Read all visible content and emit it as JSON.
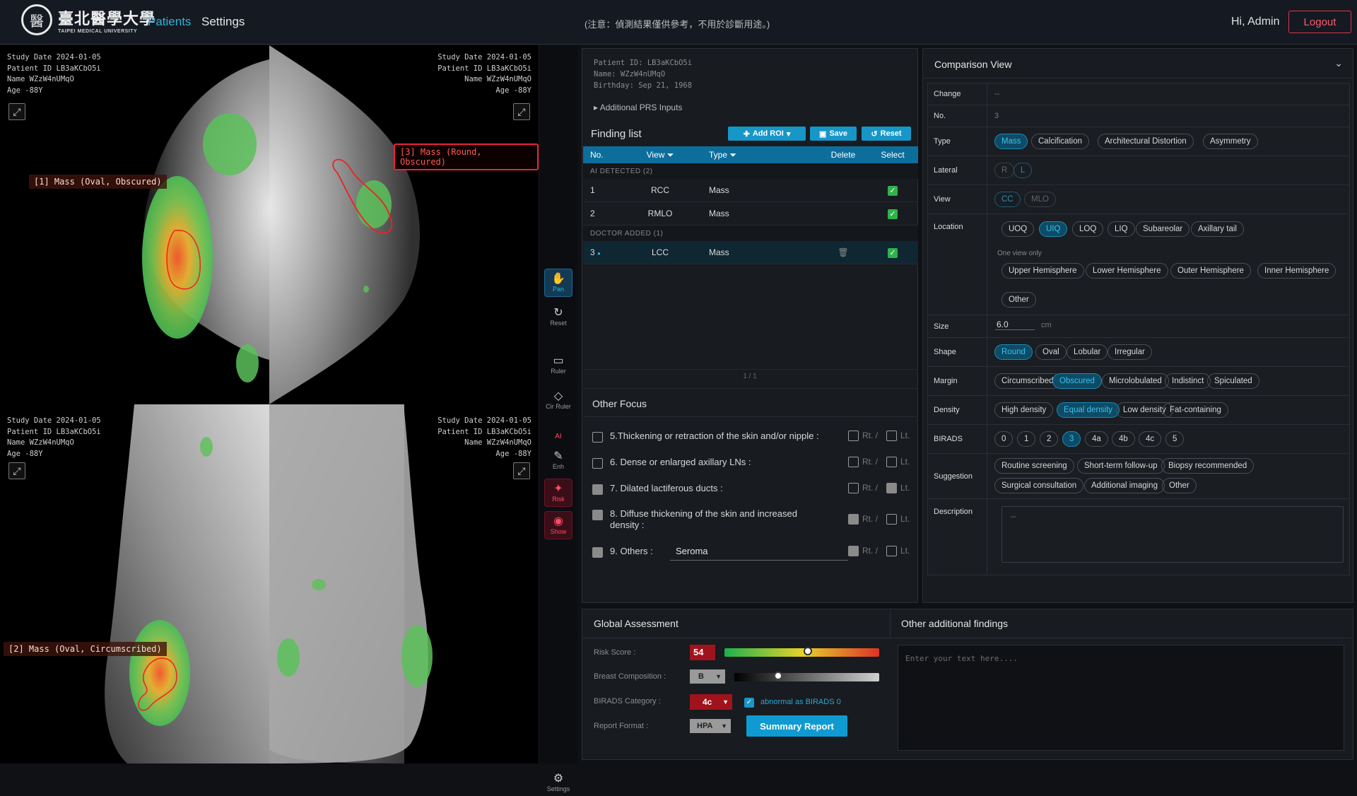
{
  "header": {
    "logo_cn": "臺北醫學大學",
    "logo_en": "TAIPEI MEDICAL UNIVERSITY",
    "nav": [
      "Patients",
      "Settings"
    ],
    "notice": "(注意：偵測結果僅供參考，不用於診斷用途。)",
    "greeting": "Hi, Admin",
    "logout": "Logout"
  },
  "viewer": {
    "rcc": {
      "study_date": "Study Date 2024-01-05",
      "patient_id": "Patient ID LB3aKCbO5i",
      "name": "Name WZzW4nUMqO",
      "age": "Age -88Y"
    },
    "lcc": {
      "study_date": "Study Date 2024-01-05",
      "patient_id": "Patient ID LB3aKCbO5i",
      "name": "Name WZzW4nUMqO",
      "age": "Age -88Y"
    },
    "rmlo": {
      "study_date": "Study Date 2024-01-05",
      "patient_id": "Patient ID LB3aKCbO5i",
      "name": "Name WZzW4nUMqO",
      "age": "Age -88Y"
    },
    "lmlo": {
      "study_date": "Study Date 2024-01-05",
      "patient_id": "Patient ID LB3aKCbO5i",
      "name": "Name WZzW4nUMqO",
      "age": "Age -88Y"
    },
    "labels": {
      "f1": "[1] Mass (Oval, Obscured)",
      "f2": "[2] Mass (Oval, Circumscribed)",
      "f3": "[3] Mass (Round, Obscured)"
    }
  },
  "tools": {
    "pan": "Pan",
    "reset": "Reset",
    "ruler": "Ruler",
    "cir_ruler": "Cir Ruler",
    "ai": "AI",
    "enh": "Enh",
    "risk": "Risk",
    "show": "Show",
    "settings": "Settings"
  },
  "patient": {
    "id": "Patient ID: LB3aKCbO5i",
    "name": "Name: WZzW4nUMqO",
    "birthday": "Birthday: Sep 21, 1968",
    "additional_prs": "▸ Additional PRS Inputs"
  },
  "finding_list": {
    "title": "Finding list",
    "add_roi": "Add ROI",
    "save": "Save",
    "reset": "Reset",
    "columns": [
      "No.",
      "View",
      "Type",
      "Delete",
      "Select"
    ],
    "group_ai": "AI DETECTED (2)",
    "group_doctor": "DOCTOR ADDED (1)",
    "rows": [
      {
        "no": "1",
        "view": "RCC",
        "type": "Mass"
      },
      {
        "no": "2",
        "view": "RMLO",
        "type": "Mass"
      },
      {
        "no": "3",
        "view": "LCC",
        "type": "Mass"
      }
    ],
    "pager": "1 / 1"
  },
  "other_focus": {
    "title": "Other Focus",
    "items": [
      "5.Thickening or retraction of the skin and/or nipple :",
      "6. Dense or enlarged axillary LNs :",
      "7. Dilated lactiferous ducts :",
      "8. Diffuse thickening of the skin and increased density :",
      "9. Others :"
    ],
    "others_value": "Seroma",
    "rt": "Rt.",
    "lt": "Lt."
  },
  "comparison": {
    "title": "Comparison View",
    "labels": {
      "change": "Change",
      "no": "No.",
      "type": "Type",
      "lateral": "Lateral",
      "view": "View",
      "location": "Location",
      "size": "Size",
      "shape": "Shape",
      "margin": "Margin",
      "density": "Density",
      "birads": "BIRADS",
      "suggestion": "Suggestion",
      "description": "Description"
    },
    "change_value": "--",
    "no_value": "3",
    "type_options": [
      "Mass",
      "Calcification",
      "Architectural Distortion",
      "Asymmetry"
    ],
    "lateral_options": [
      "R",
      "L"
    ],
    "view_options": [
      "CC",
      "MLO"
    ],
    "location_options": [
      "UOQ",
      "UIQ",
      "LOQ",
      "LIQ",
      "Subareolar",
      "Axillary tail"
    ],
    "one_view_only": "One view only",
    "hemisphere_options": [
      "Upper Hemisphere",
      "Lower Hemisphere",
      "Outer Hemisphere",
      "Inner Hemisphere"
    ],
    "location_other": "Other",
    "size_value": "6.0",
    "size_unit": "cm",
    "shape_options": [
      "Round",
      "Oval",
      "Lobular",
      "Irregular"
    ],
    "margin_options": [
      "Circumscribed",
      "Obscured",
      "Microlobulated",
      "Indistinct",
      "Spiculated"
    ],
    "density_options": [
      "High density",
      "Equal density",
      "Low density",
      "Fat-containing"
    ],
    "birads_options": [
      "0",
      "1",
      "2",
      "3",
      "4a",
      "4b",
      "4c",
      "5"
    ],
    "suggestion_options": [
      "Routine screening",
      "Short-term follow-up",
      "Biopsy recommended",
      "Surgical consultation",
      "Additional imaging",
      "Other"
    ],
    "description_value": "--"
  },
  "global_assessment": {
    "title": "Global Assessment",
    "risk_label": "Risk Score :",
    "risk_value": "54",
    "risk_fraction": 0.54,
    "composition_label": "Breast Composition :",
    "composition_value": "B",
    "composition_fraction": 0.3,
    "birads_label": "BIRADS Category :",
    "birads_value": "4c",
    "abnormal_label": "abnormal as BIRADS 0",
    "report_label": "Report Format :",
    "report_value": "HPA",
    "summary_button": "Summary Report"
  },
  "additional_findings": {
    "title": "Other additional findings",
    "placeholder": "Enter your text here...."
  }
}
